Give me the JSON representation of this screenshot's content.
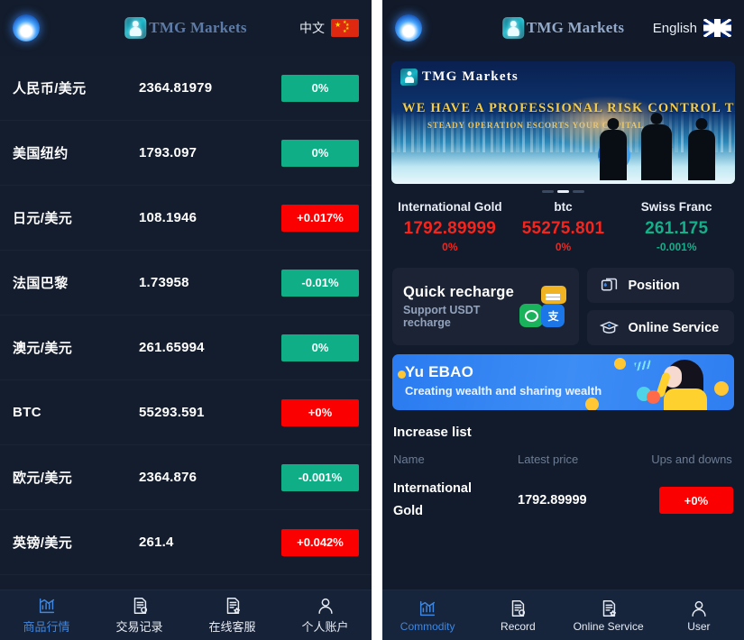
{
  "left": {
    "header": {
      "avatar_icon": "penguin-avatar-icon",
      "brand": "TMG Markets",
      "brand_mark_icon": "tmg-logo-icon",
      "language_label": "中文",
      "flag_icon": "china-flag-icon"
    },
    "quotes": [
      {
        "name": "人民币/美元",
        "price": "2364.81979",
        "change": "0%",
        "dir": "down"
      },
      {
        "name": "美国纽约",
        "price": "1793.097",
        "change": "0%",
        "dir": "down"
      },
      {
        "name": "日元/美元",
        "price": "108.1946",
        "change": "+0.017%",
        "dir": "up"
      },
      {
        "name": "法国巴黎",
        "price": "1.73958",
        "change": "-0.01%",
        "dir": "down"
      },
      {
        "name": "澳元/美元",
        "price": "261.65994",
        "change": "0%",
        "dir": "down"
      },
      {
        "name": "BTC",
        "price": "55293.591",
        "change": "+0%",
        "dir": "up"
      },
      {
        "name": "欧元/美元",
        "price": "2364.876",
        "change": "-0.001%",
        "dir": "down"
      },
      {
        "name": "英镑/美元",
        "price": "261.4",
        "change": "+0.042%",
        "dir": "up"
      }
    ],
    "tabs": [
      {
        "label": "商品行情",
        "icon": "chart-icon",
        "active": true
      },
      {
        "label": "交易记录",
        "icon": "record-icon",
        "active": false
      },
      {
        "label": "在线客服",
        "icon": "online-service-icon",
        "active": false
      },
      {
        "label": "个人账户",
        "icon": "user-icon",
        "active": false
      }
    ]
  },
  "right": {
    "header": {
      "avatar_icon": "penguin-avatar-icon",
      "brand": "TMG Markets",
      "brand_mark_icon": "tmg-logo-icon",
      "language_label": "English",
      "flag_icon": "uk-flag-icon"
    },
    "banner": {
      "logo_text": "TMG Markets",
      "headline": "WE HAVE A PROFESSIONAL RISK CONTROL TEAM",
      "subline": "STEADY OPERATION ESCORTS YOUR CAPITAL",
      "slide_index": 2,
      "slide_count": 3
    },
    "tickers": [
      {
        "name": "International Gold",
        "price": "1792.89999",
        "change": "0%",
        "dir": "up"
      },
      {
        "name": "btc",
        "price": "55275.801",
        "change": "0%",
        "dir": "up"
      },
      {
        "name": "Swiss Franc",
        "price": "261.175",
        "change": "-0.001%",
        "dir": "down"
      }
    ],
    "recharge": {
      "title": "Quick recharge",
      "subtitle": "Support USDT recharge",
      "icons": [
        "bank-card-icon",
        "wechat-pay-icon",
        "alipay-icon"
      ]
    },
    "side_buttons": [
      {
        "label": "Position",
        "icon": "position-icon"
      },
      {
        "label": "Online Service",
        "icon": "graduation-cap-icon"
      }
    ],
    "promo": {
      "title": "Yu EBAO",
      "subtitle": "Creating wealth and sharing wealth"
    },
    "increase_list": {
      "title": "Increase list",
      "columns": {
        "name": "Name",
        "price": "Latest price",
        "change": "Ups and downs"
      },
      "rows": [
        {
          "name_line1": "International",
          "name_line2": "Gold",
          "price": "1792.89999",
          "change": "+0%",
          "dir": "up"
        }
      ]
    },
    "tabs": [
      {
        "label": "Commodity",
        "icon": "chart-icon",
        "active": true
      },
      {
        "label": "Record",
        "icon": "record-icon",
        "active": false
      },
      {
        "label": "Online Service",
        "icon": "online-service-icon",
        "active": false
      },
      {
        "label": "User",
        "icon": "user-icon",
        "active": false
      }
    ]
  },
  "colors": {
    "up": "#fa0000",
    "down": "#0fae87",
    "accent": "#3f87e0",
    "bg": "#141d2d",
    "card": "#1b2334"
  }
}
